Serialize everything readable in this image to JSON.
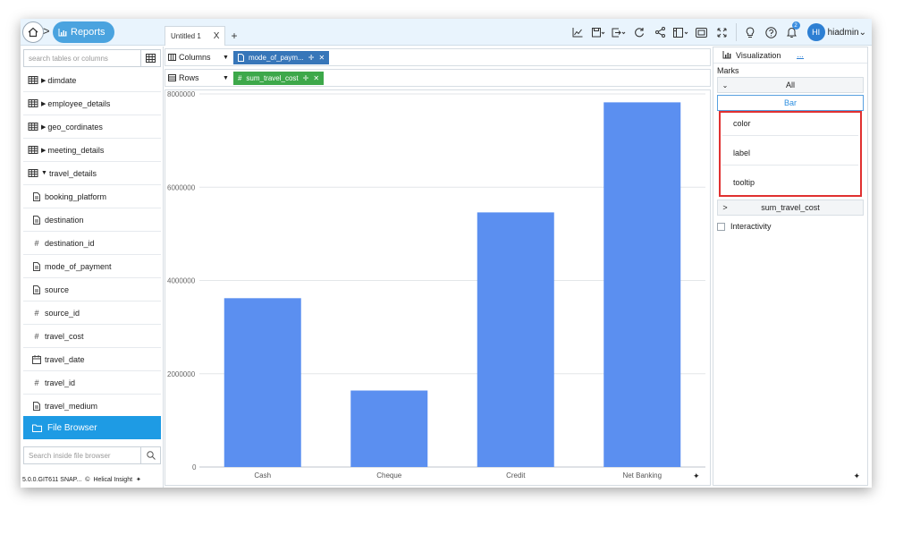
{
  "header": {
    "reports_label": "Reports",
    "tab_title": "Untitled 1",
    "tab_close": "X",
    "tab_add": "+",
    "notification_count": "2",
    "avatar_initials": "HI",
    "username": "hiadmin"
  },
  "sidebar": {
    "search_placeholder": "search tables or columns",
    "tables": [
      {
        "label": "dimdate",
        "expanded": false
      },
      {
        "label": "employee_details",
        "expanded": false
      },
      {
        "label": "geo_cordinates",
        "expanded": false
      },
      {
        "label": "meeting_details",
        "expanded": false
      },
      {
        "label": "travel_details",
        "expanded": true
      }
    ],
    "fields": [
      {
        "label": "booking_platform",
        "icon": "text-field-icon"
      },
      {
        "label": "destination",
        "icon": "text-field-icon"
      },
      {
        "label": "destination_id",
        "icon": "numeric-field-icon"
      },
      {
        "label": "mode_of_payment",
        "icon": "text-field-icon"
      },
      {
        "label": "source",
        "icon": "text-field-icon"
      },
      {
        "label": "source_id",
        "icon": "numeric-field-icon"
      },
      {
        "label": "travel_cost",
        "icon": "numeric-field-icon"
      },
      {
        "label": "travel_date",
        "icon": "date-field-icon"
      },
      {
        "label": "travel_id",
        "icon": "numeric-field-icon"
      },
      {
        "label": "travel_medium",
        "icon": "text-field-icon"
      }
    ],
    "file_browser_label": "File Browser",
    "file_browser_search_placeholder": "Search inside file browser",
    "version": "5.0.0.GIT611 SNAP...",
    "brand": "Helical Insight"
  },
  "shelves": {
    "columns_label": "Columns",
    "columns_pill": "mode_of_paym...",
    "rows_label": "Rows",
    "rows_pill": "sum_travel_cost"
  },
  "right_panel": {
    "tab_label": "Visualization",
    "more_label": "...",
    "marks_label": "Marks",
    "all_label": "All",
    "chart_type": "Bar",
    "mark_items": [
      "color",
      "label",
      "tooltip"
    ],
    "measure_label": "sum_travel_cost",
    "interactivity_label": "Interactivity"
  },
  "colors": {
    "bar": "#5b8ff0",
    "accent": "#1e9be4",
    "highlight_box": "#e03030"
  },
  "chart_data": {
    "type": "bar",
    "categories": [
      "Cash",
      "Cheque",
      "Credit",
      "Net Banking"
    ],
    "values": [
      3620000,
      1640000,
      5460000,
      7820000
    ],
    "ylim": [
      0,
      8000000
    ],
    "yticks": [
      "0",
      "2000000",
      "4000000",
      "6000000",
      "8000000"
    ],
    "grid": true
  }
}
